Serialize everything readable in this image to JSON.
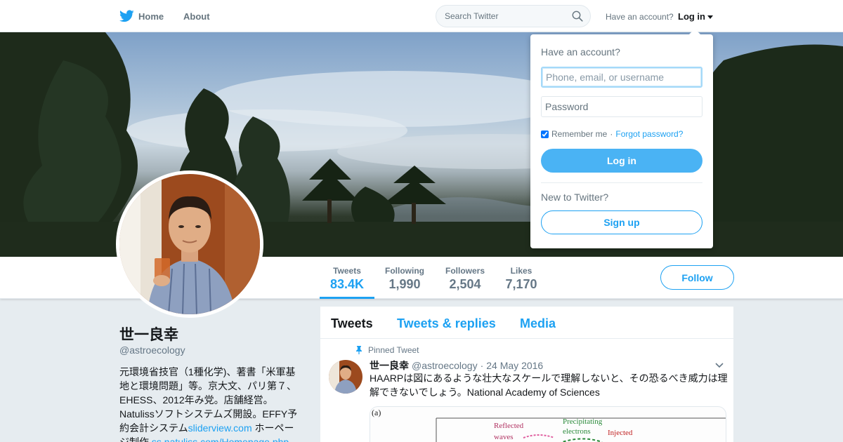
{
  "nav": {
    "home_label": "Home",
    "about_label": "About",
    "search_placeholder": "Search Twitter",
    "have_account": "Have an account?",
    "login_label": "Log in",
    "icons": [
      "twitter-bird-icon",
      "search-icon",
      "caret-down-icon"
    ]
  },
  "profile": {
    "name": "世一良幸",
    "handle": "@astroecology",
    "bio_text": "元環境省技官（1種化学)、著書「米軍基地と環境問題」等。京大文、パリ第７、EHESS、2012年み党。店舗経営。Natulissソフトシステムズ開設。EFFY予約会計システム",
    "bio_link1": "sliderview.com",
    "bio_after_link1": " ホーページ制作",
    "bio_link2": "ss.natuliss.com/Homepage.php"
  },
  "stats": [
    {
      "label": "Tweets",
      "value": "83.4K"
    },
    {
      "label": "Following",
      "value": "1,990"
    },
    {
      "label": "Followers",
      "value": "2,504"
    },
    {
      "label": "Likes",
      "value": "7,170"
    }
  ],
  "follow_label": "Follow",
  "timeline": {
    "tabs": [
      "Tweets",
      "Tweets & replies",
      "Media"
    ],
    "pinned_label": "Pinned Tweet",
    "tweet": {
      "name": "世一良幸",
      "handle": "@astroecology",
      "date": "24 May 2016",
      "text": "HAARPは図にあるような壮大なスケールで理解しないと、その恐るべき威力は理解できないでしょう。National Academy of Sciences",
      "media_labels": [
        "(a)",
        "Reflected",
        "waves",
        "Precipitating",
        "electrons",
        "Injected"
      ]
    }
  },
  "login_dropdown": {
    "title": "Have an account?",
    "username_placeholder": "Phone, email, or username",
    "password_placeholder": "Password",
    "remember_label": "Remember me",
    "separator": "·",
    "forgot_label": "Forgot password?",
    "login_button": "Log in",
    "new_label": "New to Twitter?",
    "signup_button": "Sign up"
  },
  "colors": {
    "accent": "#1da1f2",
    "login_button": "#4ab3f4",
    "background": "#e6ecf0"
  }
}
